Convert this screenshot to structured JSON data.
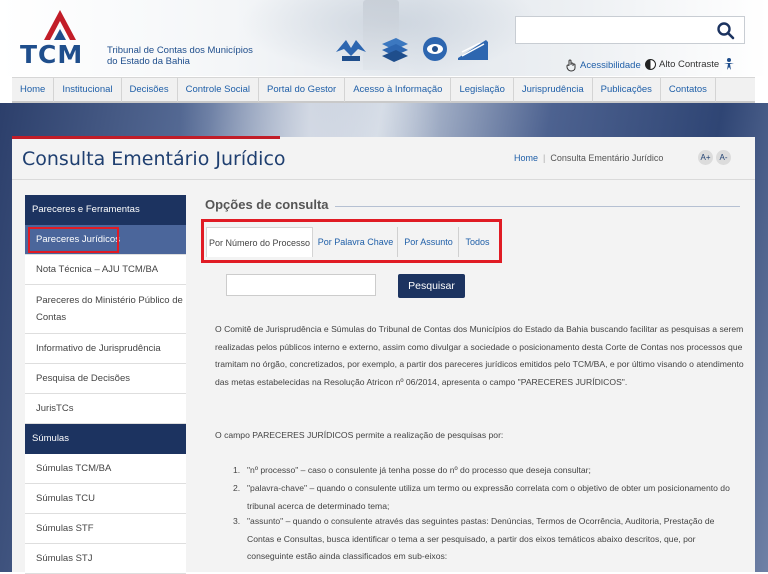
{
  "header": {
    "logo_text": "TCM",
    "logo_line1": "Tribunal de Contas dos Municípios",
    "logo_line2": "do Estado da Bahia",
    "search_placeholder": "",
    "accessibility_label": "Acessibilidade",
    "contrast_label": "Alto Contraste",
    "colors": {
      "brand_blue": "#1f4e8c",
      "accent_red": "#c21d28"
    }
  },
  "nav": {
    "items": [
      "Home",
      "Institucional",
      "Decisões",
      "Controle Social",
      "Portal do Gestor",
      "Acesso à Informação",
      "Legislação",
      "Jurisprudência",
      "Publicações",
      "Contatos"
    ]
  },
  "page": {
    "title": "Consulta Ementário Jurídico",
    "breadcrumb_home": "Home",
    "breadcrumb_current": "Consulta Ementário Jurídico",
    "font_increase": "A+",
    "font_decrease": "A-"
  },
  "sidebar": {
    "section1_title": "Pareceres e Ferramentas",
    "section1_items": [
      "Pareceres Jurídicos",
      "Nota Técnica – AJU TCM/BA",
      "Pareceres do Ministério Público de Contas",
      "Informativo de Jurisprudência",
      "Pesquisa de Decisões",
      "JurisTCs"
    ],
    "section2_title": "Súmulas",
    "section2_items": [
      "Súmulas TCM/BA",
      "Súmulas TCU",
      "Súmulas STF",
      "Súmulas STJ"
    ]
  },
  "main": {
    "options_title": "Opções de consulta",
    "tabs": [
      "Por Número do Processo",
      "Por Palavra Chave",
      "Por Assunto",
      "Todos"
    ],
    "search_value": "",
    "search_button": "Pesquisar",
    "para1": "O Comitê de Jurisprudência e Súmulas do Tribunal de Contas dos Municípios do Estado da Bahia buscando facilitar as pesquisas a serem realizadas pelos públicos interno e externo, assim como divulgar a sociedade o posicionamento desta Corte de Contas nos processos que tramitam no órgão, concretizados, por exemplo, a partir dos pareceres jurídicos emitidos pelo TCM/BA, e por último visando o atendimento das metas estabelecidas na Resolução Atricon nº 06/2014, apresenta o campo \"PARECERES JURÍDICOS\".",
    "para2": "O campo PARECERES JURÍDICOS permite a realização de pesquisas por:",
    "list": [
      {
        "num": "1.",
        "text": "\"nº processo\" – caso o consulente já tenha posse do nº do processo que deseja consultar;"
      },
      {
        "num": "2.",
        "text": "\"palavra-chave\" – quando o consulente utiliza um termo ou expressão correlata com o objetivo de obter um posicionamento do tribunal acerca de determinado tema;"
      },
      {
        "num": "3.",
        "text": "\"assunto\" – quando o consulente através das seguintes pastas: Denúncias, Termos de Ocorrência, Auditoria, Prestação de Contas e Consultas, busca identificar o tema a ser pesquisado, a partir dos eixos temáticos abaixo descritos, que, por conseguinte estão ainda classificados em sub-eixos:"
      }
    ]
  }
}
